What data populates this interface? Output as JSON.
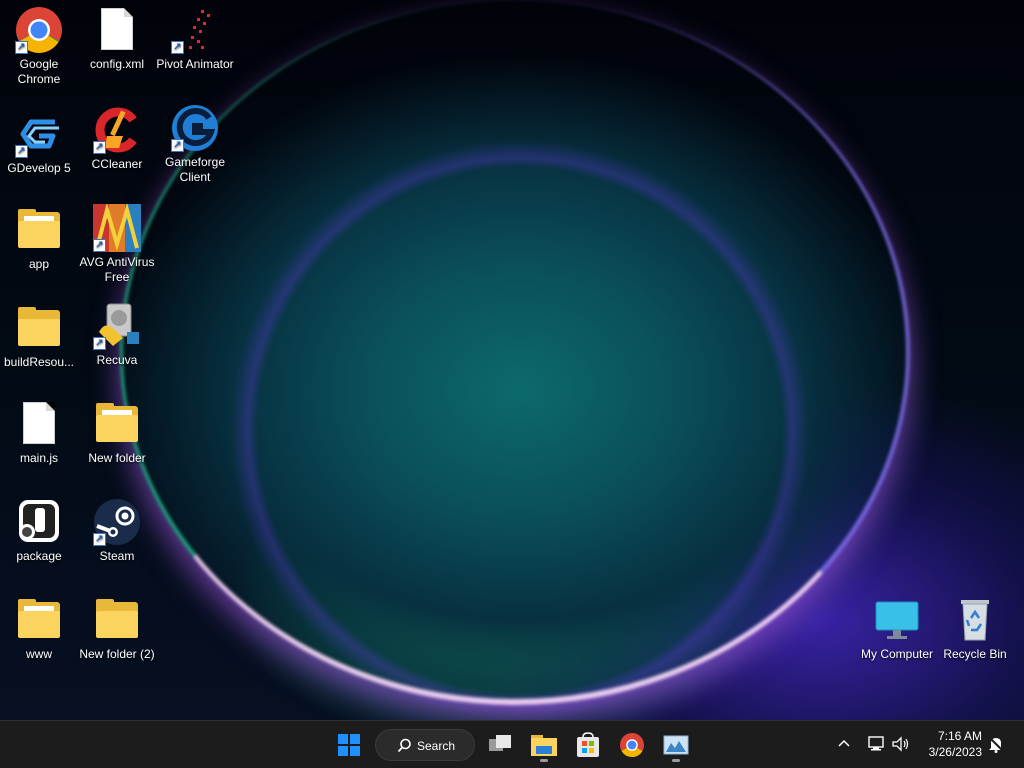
{
  "desktop": {
    "icons": [
      {
        "label": "Google Chrome"
      },
      {
        "label": "config.xml"
      },
      {
        "label": "Pivot Animator"
      },
      {
        "label": "GDevelop 5"
      },
      {
        "label": "CCleaner"
      },
      {
        "label": "Gameforge Client"
      },
      {
        "label": "app"
      },
      {
        "label": "AVG AntiVirus Free"
      },
      {
        "label": "buildResou..."
      },
      {
        "label": "Recuva"
      },
      {
        "label": "main.js"
      },
      {
        "label": "New folder"
      },
      {
        "label": "package"
      },
      {
        "label": "Steam"
      },
      {
        "label": "www"
      },
      {
        "label": "New folder (2)"
      },
      {
        "label": "My Computer"
      },
      {
        "label": "Recycle Bin"
      }
    ]
  },
  "taskbar": {
    "search_label": "Search",
    "clock_time": "7:16 AM",
    "clock_date": "3/26/2023"
  },
  "colors": {
    "taskbar_bg": "#1c1c1c",
    "windows_blue": "#1e90ff",
    "folder_yellow": "#fbd35f"
  }
}
